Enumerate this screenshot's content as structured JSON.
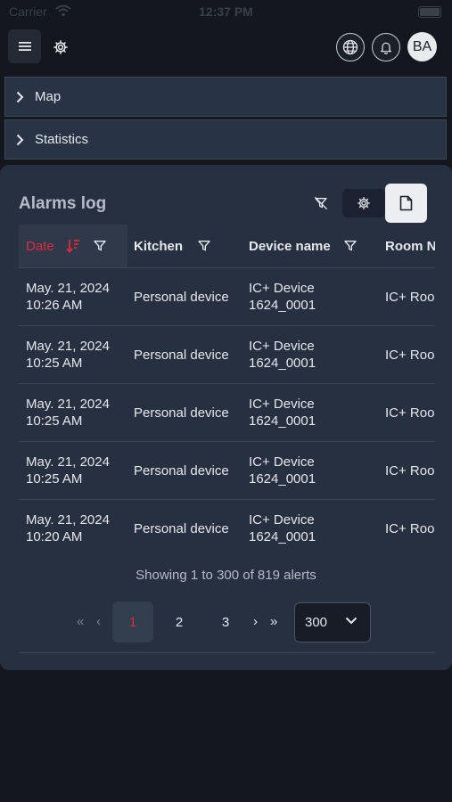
{
  "status_bar": {
    "carrier": "Carrier",
    "time": "12:37 PM"
  },
  "header": {
    "avatar_initials": "BA",
    "icons": [
      "menu-icon",
      "gear-icon",
      "globe-icon",
      "bell-icon"
    ]
  },
  "accordions": [
    {
      "label": "Map"
    },
    {
      "label": "Statistics"
    }
  ],
  "alarms": {
    "title": "Alarms log",
    "columns": [
      "Date",
      "Kitchen",
      "Device name",
      "Room N"
    ],
    "rows": [
      {
        "date_line1": "May. 21, 2024",
        "date_line2": "10:26 AM",
        "kitchen": "Personal device",
        "device_line1": "IC+ Device",
        "device_line2": "1624_0001",
        "room": "IC+ Roo"
      },
      {
        "date_line1": "May. 21, 2024",
        "date_line2": "10:25 AM",
        "kitchen": "Personal device",
        "device_line1": "IC+ Device",
        "device_line2": "1624_0001",
        "room": "IC+ Roo"
      },
      {
        "date_line1": "May. 21, 2024",
        "date_line2": "10:25 AM",
        "kitchen": "Personal device",
        "device_line1": "IC+ Device",
        "device_line2": "1624_0001",
        "room": "IC+ Roo"
      },
      {
        "date_line1": "May. 21, 2024",
        "date_line2": "10:25 AM",
        "kitchen": "Personal device",
        "device_line1": "IC+ Device",
        "device_line2": "1624_0001",
        "room": "IC+ Roo"
      },
      {
        "date_line1": "May. 21, 2024",
        "date_line2": "10:20 AM",
        "kitchen": "Personal device",
        "device_line1": "IC+ Device",
        "device_line2": "1624_0001",
        "room": "IC+ Roo"
      }
    ],
    "showing": "Showing 1 to 300 of 819 alerts",
    "pagination": {
      "first": "«",
      "prev": "‹",
      "pages": [
        "1",
        "2",
        "3"
      ],
      "current": "1",
      "next": "›",
      "last": "»",
      "page_size": "300"
    }
  },
  "colors": {
    "accent": "#e0293f",
    "panel": "#263041",
    "background": "#14171d"
  }
}
